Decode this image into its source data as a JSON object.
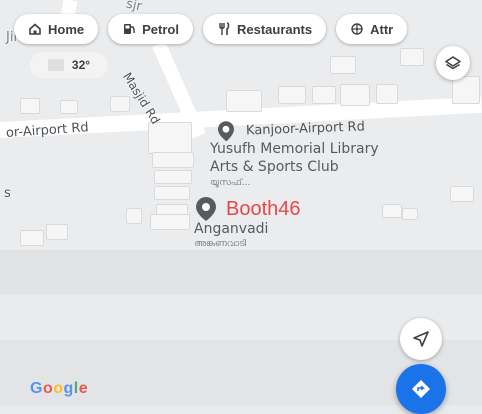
{
  "map": {
    "roads": {
      "top_road": "Jin...",
      "top_road_2": "sjr",
      "masjid_rd": "Masjid Rd",
      "airport_rd_left": "or-Airport Rd",
      "left_edge": "s"
    }
  },
  "chips": [
    {
      "label": "Home",
      "icon": "home-icon"
    },
    {
      "label": "Petrol",
      "icon": "fuel-pump-icon"
    },
    {
      "label": "Restaurants",
      "icon": "fork-knife-icon"
    },
    {
      "label": "Attr",
      "icon": "attractions-icon"
    }
  ],
  "weather": {
    "temperature": "32°"
  },
  "places": {
    "kanjoor_road": {
      "label": "Kanjoor-Airport Rd"
    },
    "library": {
      "line1": "Yusufh Memorial Library",
      "line2": "Arts & Sports Club",
      "local_name": "യൂസഫ്..."
    },
    "booth": {
      "label": "Booth46",
      "color": "#e8474a"
    },
    "anganvadi": {
      "label": "Anganvadi",
      "local_name": "അങ്കണവാടി"
    }
  },
  "brand": {
    "logo": "Google"
  },
  "colors": {
    "accent": "#1a73e8",
    "pin": "#555b61",
    "booth": "#e8474a"
  }
}
